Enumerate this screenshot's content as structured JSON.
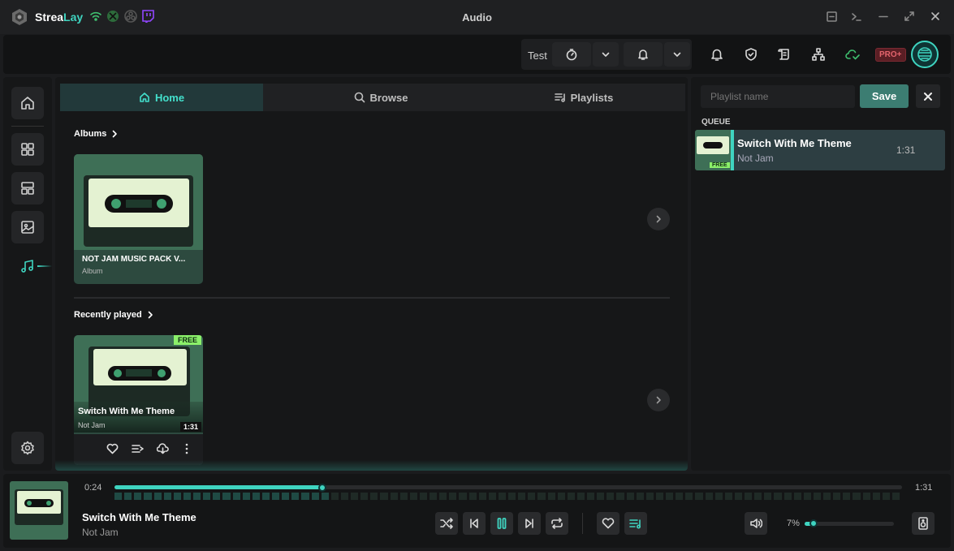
{
  "app": {
    "name_part1": "Strea",
    "name_part2": "Lay",
    "window_title": "Audio"
  },
  "toolbar": {
    "profile_label": "Test",
    "pro_badge": "PRO+"
  },
  "tabs": [
    {
      "label": "Home",
      "icon": "home-icon",
      "active": true
    },
    {
      "label": "Browse",
      "icon": "search-icon",
      "active": false
    },
    {
      "label": "Playlists",
      "icon": "playlist-icon",
      "active": false
    }
  ],
  "albums": {
    "title": "Albums",
    "items": [
      {
        "title": "NOT JAM MUSIC PACK V...",
        "subtitle": "Album"
      }
    ]
  },
  "recently_played": {
    "title": "Recently played",
    "items": [
      {
        "title": "Switch With Me Theme",
        "artist": "Not Jam",
        "duration": "1:31",
        "badge": "FREE"
      }
    ]
  },
  "queue": {
    "playlist_placeholder": "Playlist name",
    "save_label": "Save",
    "header": "QUEUE",
    "items": [
      {
        "title": "Switch With Me Theme",
        "artist": "Not Jam",
        "duration": "1:31",
        "badge": "FREE"
      }
    ]
  },
  "player": {
    "title": "Switch With Me Theme",
    "artist": "Not Jam",
    "elapsed": "0:24",
    "total": "1:31",
    "progress_fraction": 0.264,
    "volume_label": "7%",
    "volume_fraction": 0.07
  },
  "colors": {
    "accent": "#3fd4c0",
    "free_badge": "#8bf06a",
    "save": "#3c7d72",
    "pro": "#e3646d"
  }
}
